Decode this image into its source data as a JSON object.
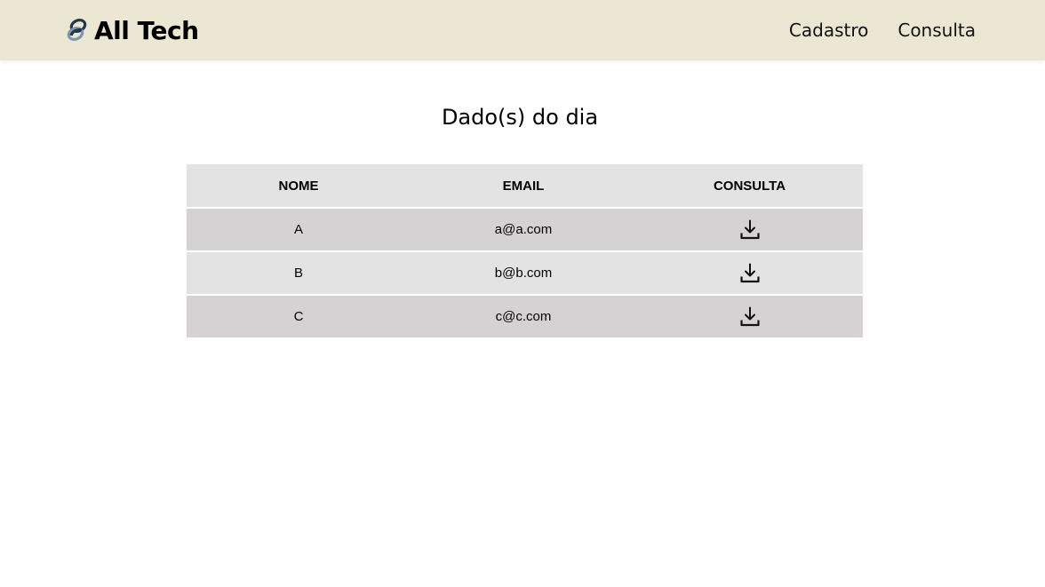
{
  "header": {
    "brand": "All Tech",
    "nav": [
      {
        "label": "Cadastro"
      },
      {
        "label": "Consulta"
      }
    ],
    "background": "#ece7d2"
  },
  "main": {
    "title": "Dado(s) do dia",
    "table": {
      "columns": [
        "NOME",
        "EMAIL",
        "CONSULTA"
      ],
      "rows": [
        {
          "nome": "A",
          "email": "a@a.com",
          "consulta": "download-icon"
        },
        {
          "nome": "B",
          "email": "b@b.com",
          "consulta": "download-icon"
        },
        {
          "nome": "C",
          "email": "c@c.com",
          "consulta": "download-icon"
        }
      ]
    }
  },
  "colors": {
    "header_row": "#e3e3e3",
    "row_dark": "#d4d2d3",
    "row_light": "#e3e3e3"
  }
}
